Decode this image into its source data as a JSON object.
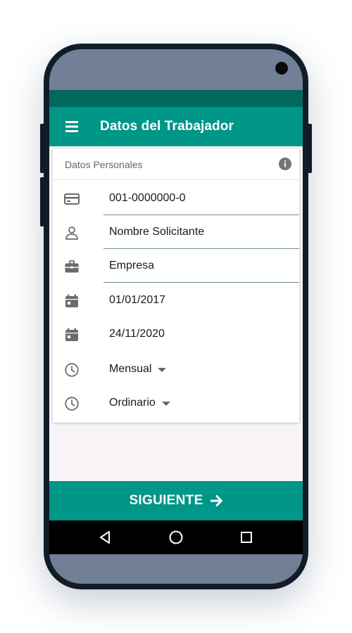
{
  "app_bar": {
    "title": "Datos del Trabajador",
    "menu_icon": "menu-icon"
  },
  "card": {
    "title": "Datos Personales",
    "info_icon": "info-icon",
    "fields": [
      {
        "icon": "credit-card-icon",
        "value": "001-0000000-0"
      },
      {
        "icon": "person-icon",
        "value": "Nombre Solicitante"
      },
      {
        "icon": "briefcase-icon",
        "value": "Empresa"
      },
      {
        "icon": "calendar-icon",
        "value": "01/01/2017"
      },
      {
        "icon": "calendar-icon",
        "value": "24/11/2020"
      },
      {
        "icon": "clock-icon",
        "value": "Mensual"
      },
      {
        "icon": "clock-icon",
        "value": "Ordinario"
      }
    ]
  },
  "footer": {
    "next_label": "SIGUIENTE",
    "next_icon": "arrow-right-icon"
  },
  "nav_bar": {
    "back_icon": "back-triangle-icon",
    "home_icon": "home-circle-icon",
    "recents_icon": "recents-square-icon"
  },
  "colors": {
    "primary": "#009688",
    "primary_dark": "#00695c",
    "background": "#f7f3f6",
    "device_frame": "#111c27"
  }
}
